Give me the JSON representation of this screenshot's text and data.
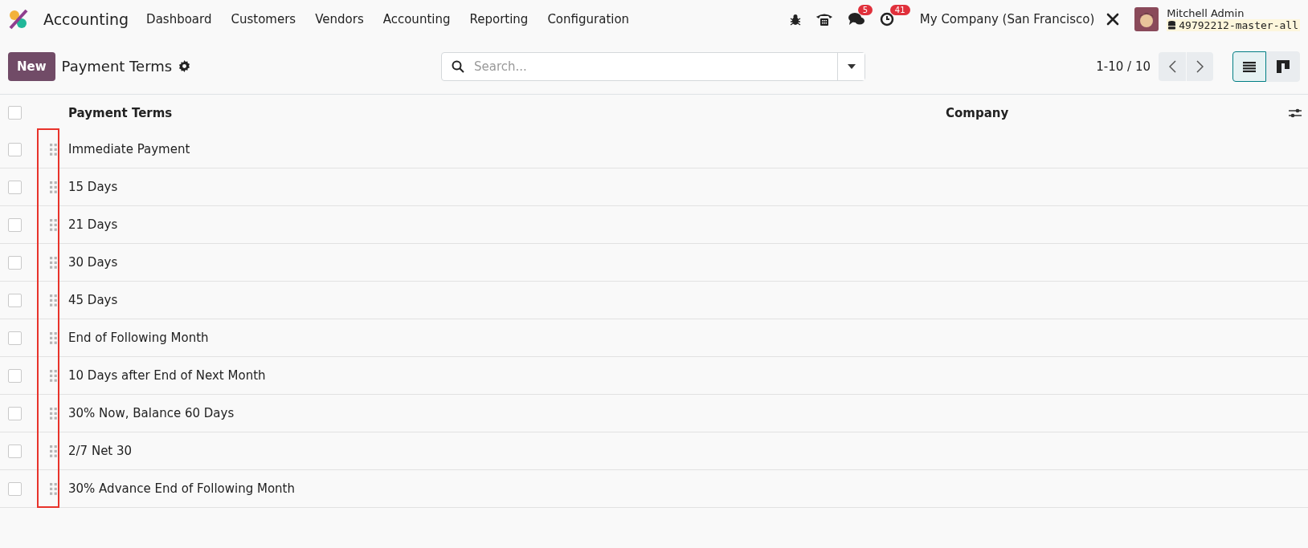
{
  "navbar": {
    "app_name": "Accounting",
    "menu": [
      "Dashboard",
      "Customers",
      "Vendors",
      "Accounting",
      "Reporting",
      "Configuration"
    ],
    "messages_badge": "5",
    "activities_badge": "41",
    "company": "My Company (San Francisco)",
    "user": {
      "name": "Mitchell Admin",
      "database": "49792212-master-all"
    }
  },
  "control_panel": {
    "new_button": "New",
    "title": "Payment Terms",
    "search": {
      "placeholder": "Search..."
    },
    "pager": "1-10 / 10",
    "views": [
      {
        "kind": "list",
        "selected": true
      },
      {
        "kind": "kanban",
        "selected": false
      }
    ]
  },
  "table": {
    "select_all": {
      "checked": false
    },
    "columns": [
      "Payment Terms",
      "Company"
    ],
    "rows": [
      {
        "name": "Immediate Payment",
        "checked": false
      },
      {
        "name": "15 Days",
        "checked": false
      },
      {
        "name": "21 Days",
        "checked": false
      },
      {
        "name": "30 Days",
        "checked": false
      },
      {
        "name": "45 Days",
        "checked": false
      },
      {
        "name": "End of Following Month",
        "checked": false
      },
      {
        "name": "10 Days after End of Next Month",
        "checked": false
      },
      {
        "name": "30% Now, Balance 60 Days",
        "checked": false
      },
      {
        "name": "2/7 Net 30",
        "checked": false
      },
      {
        "name": "30% Advance End of Following Month",
        "checked": false
      }
    ]
  }
}
